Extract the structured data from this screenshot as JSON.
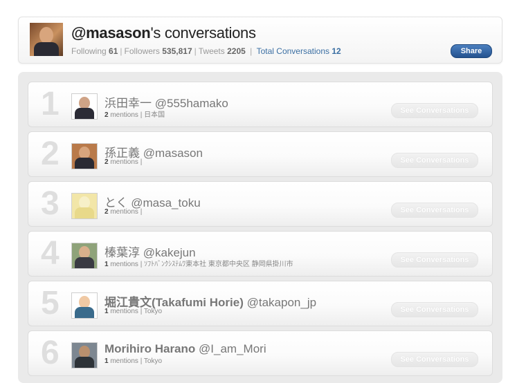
{
  "header": {
    "handle": "@masason",
    "title_suffix": "'s conversations",
    "stats": {
      "following_label": "Following",
      "following": "61",
      "followers_label": "Followers",
      "followers": "535,817",
      "tweets_label": "Tweets",
      "tweets": "2205",
      "total_label": "Total Conversations",
      "total": "12"
    },
    "share_label": "Share"
  },
  "conversations": [
    {
      "rank": "1",
      "display_name": "浜田幸一",
      "handle": "@555hamako",
      "mentions": "2",
      "mentions_label": "mentions",
      "location": "日本国",
      "button": "See Conversations"
    },
    {
      "rank": "2",
      "display_name": "孫正義",
      "handle": "@masason",
      "mentions": "2",
      "mentions_label": "mentions",
      "location": "",
      "button": "See Conversations"
    },
    {
      "rank": "3",
      "display_name": "とく",
      "handle": "@masa_toku",
      "mentions": "2",
      "mentions_label": "mentions",
      "location": "",
      "button": "See Conversations"
    },
    {
      "rank": "4",
      "display_name": "榛葉淳",
      "handle": "@kakejun",
      "mentions": "1",
      "mentions_label": "mentions",
      "location": "ｿﾌﾄﾊﾞﾝｸｼｽﾃﾑﾜ東本社  東京都中央区  静岡県掛川市",
      "button": "See Conversations"
    },
    {
      "rank": "5",
      "display_name": "堀江貴文(Takafumi Horie)",
      "handle": "@takapon_jp",
      "mentions": "1",
      "mentions_label": "mentions",
      "location": "Tokyo",
      "button": "See Conversations"
    },
    {
      "rank": "6",
      "display_name": "Morihiro Harano",
      "handle": "@I_am_Mori",
      "mentions": "1",
      "mentions_label": "mentions",
      "location": "Tokyo",
      "button": "See Conversations"
    }
  ]
}
